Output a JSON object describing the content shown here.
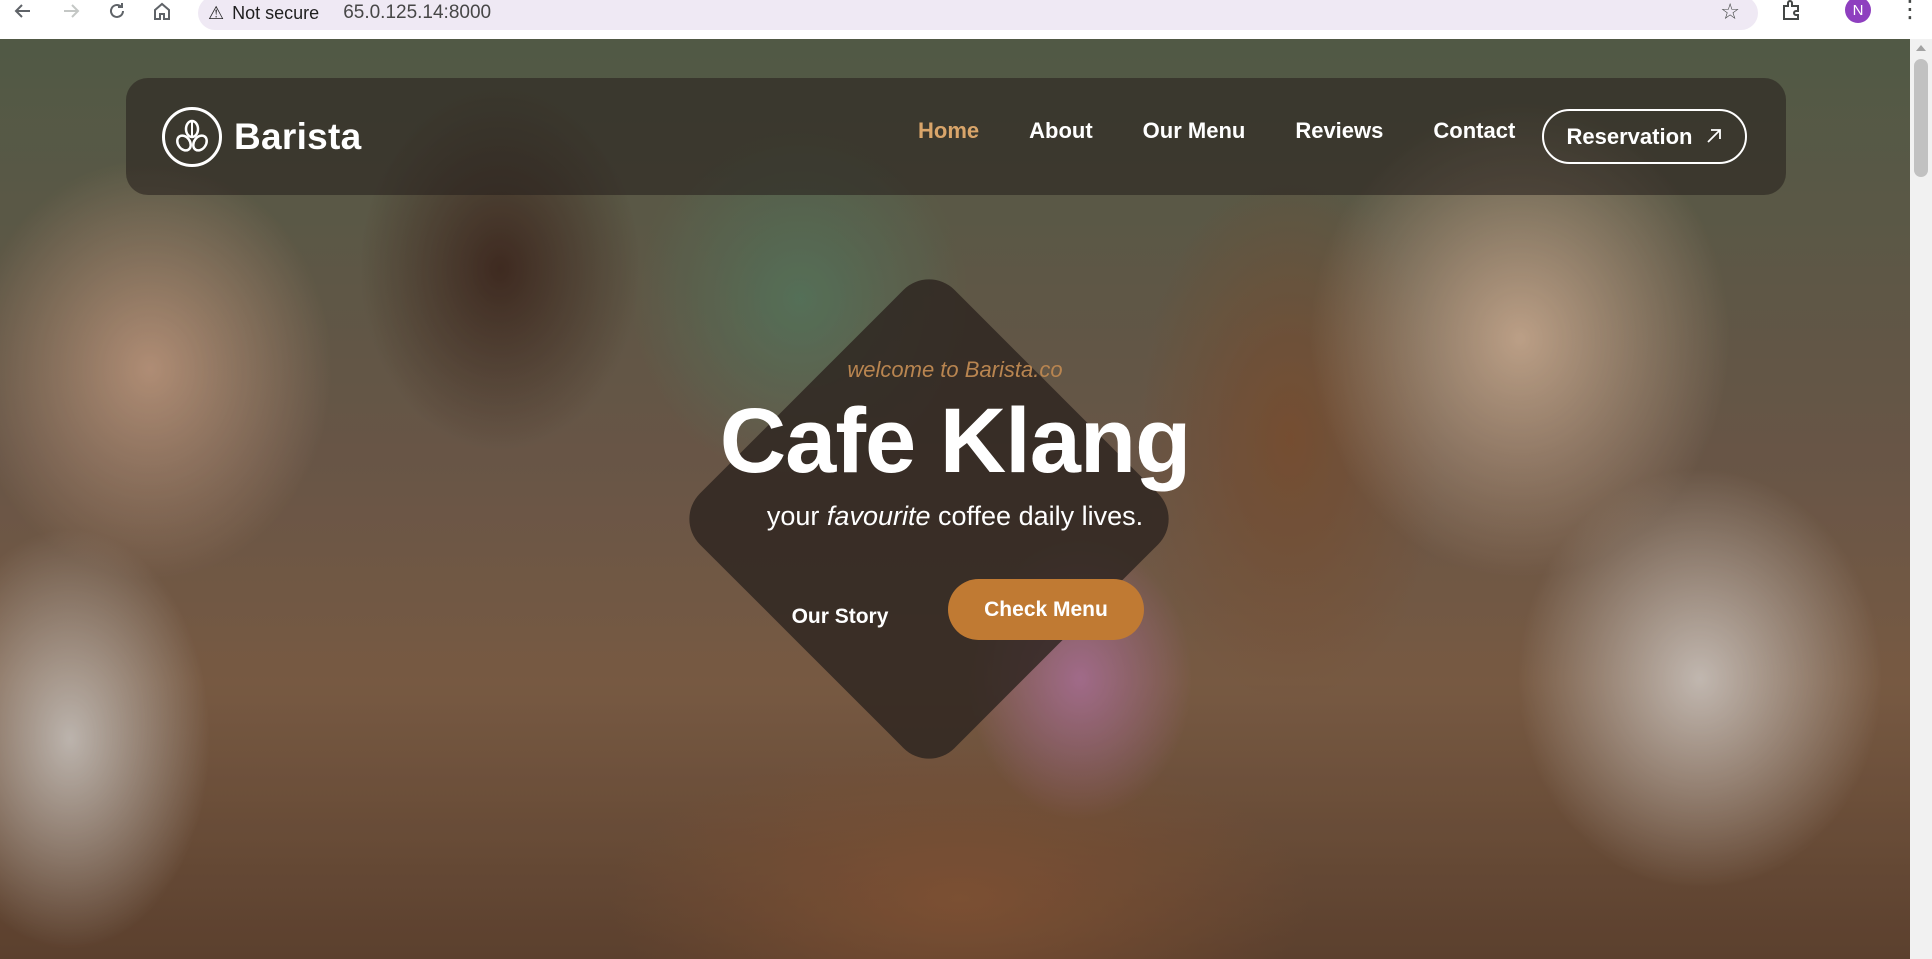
{
  "browser": {
    "security_label": "Not secure",
    "url": "65.0.125.14:8000",
    "profile_initial": "N"
  },
  "header": {
    "brand": "Barista",
    "nav": [
      {
        "label": "Home",
        "active": true
      },
      {
        "label": "About",
        "active": false
      },
      {
        "label": "Our Menu",
        "active": false
      },
      {
        "label": "Reviews",
        "active": false
      },
      {
        "label": "Contact",
        "active": false
      }
    ],
    "reservation_label": "Reservation",
    "active_color": "#d9a56a"
  },
  "hero": {
    "welcome": "welcome to Barista.co",
    "title": "Cafe Klang",
    "subtitle_before": "your",
    "subtitle_emphasis": "favourite",
    "subtitle_after": "coffee daily lives.",
    "our_story_label": "Our Story",
    "check_menu_label": "Check Menu",
    "accent_color": "#c07a33"
  }
}
